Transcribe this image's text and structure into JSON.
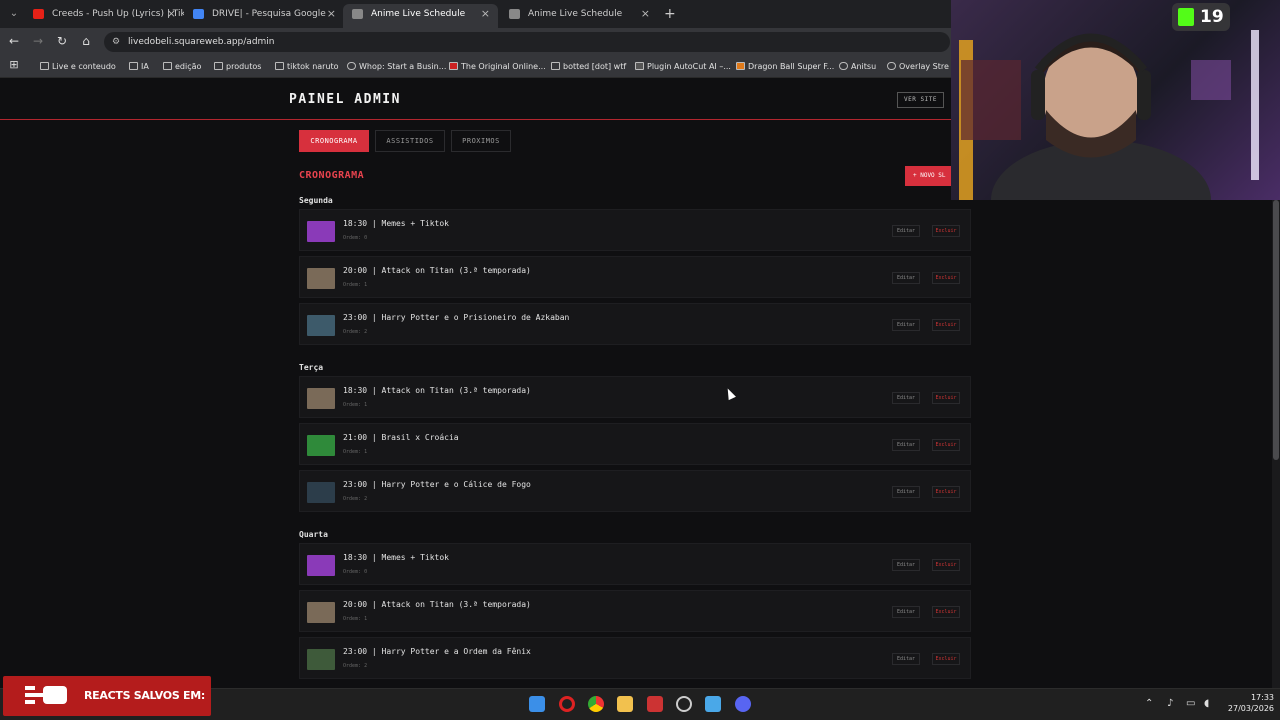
{
  "browser": {
    "tabs": [
      {
        "label": "Creeds - Push Up (Lyrics) | Tiktok",
        "favicon_color": "#e62117"
      },
      {
        "label": "DRIVE| - Pesquisa Google",
        "favicon_color": "#4285f4"
      },
      {
        "label": "Anime Live Schedule",
        "favicon_color": "#888888"
      },
      {
        "label": "Anime Live Schedule",
        "favicon_color": "#888888"
      }
    ],
    "tab_close_glyph": "×",
    "new_tab_glyph": "+",
    "url": "livedobeli.squareweb.app/admin",
    "bookmarks": [
      "Live e conteudo",
      "IA",
      "edição",
      "produtos",
      "tiktok naruto",
      "Whop: Start a Busin...",
      "The Original Online...",
      "botted [dot] wtf",
      "Plugin AutoCut AI –...",
      "Dragon Ball Super F...",
      "Anitsu",
      "Overlay Stre"
    ]
  },
  "admin": {
    "title": "PAINEL ADMIN",
    "ver_site": "VER SITE",
    "nav_tabs": [
      "CRONOGRAMA",
      "ASSISTIDOS",
      "PROXIMOS"
    ],
    "section_title": "CRONOGRAMA",
    "new_button": "+ NOVO SL",
    "edit_label": "Editar",
    "delete_label": "Excluir",
    "days": [
      {
        "name": "Segunda",
        "items": [
          {
            "text": "18:30 | Memes + Tiktok",
            "order": "Ordem: 0",
            "thumb": "#8a3ab8"
          },
          {
            "text": "20:00 | Attack on Titan (3.ª temporada)",
            "order": "Ordem: 1",
            "thumb": "#7a6a58"
          },
          {
            "text": "23:00 | Harry Potter e o Prisioneiro de Azkaban",
            "order": "Ordem: 2",
            "thumb": "#3d5a6a"
          }
        ]
      },
      {
        "name": "Terça",
        "items": [
          {
            "text": "18:30 | Attack on Titan (3.ª temporada)",
            "order": "Ordem: 1",
            "thumb": "#7a6a58"
          },
          {
            "text": "21:00 | Brasil x Croácia",
            "order": "Ordem: 1",
            "thumb": "#2f8a3a"
          },
          {
            "text": "23:00 | Harry Potter e o Cálice de Fogo",
            "order": "Ordem: 2",
            "thumb": "#2c3d4a"
          }
        ]
      },
      {
        "name": "Quarta",
        "items": [
          {
            "text": "18:30 | Memes + Tiktok",
            "order": "Ordem: 0",
            "thumb": "#8a3ab8"
          },
          {
            "text": "20:00 | Attack on Titan (3.ª temporada)",
            "order": "Ordem: 1",
            "thumb": "#7a6a58"
          },
          {
            "text": "23:00 | Harry Potter e a Ordem da Fênix",
            "order": "Ordem: 2",
            "thumb": "#3e5a3a"
          }
        ]
      }
    ]
  },
  "overlay": {
    "kick_count": "19",
    "reacts_banner": "REACTS SALVOS EM:"
  },
  "taskbar": {
    "time": "17:33",
    "date": "27/03/2026",
    "apps": [
      "windows-start",
      "opera",
      "chrome",
      "file-explorer",
      "calendar-app",
      "steam",
      "notepad",
      "discord"
    ]
  },
  "colors": {
    "accent": "#d7303d",
    "background": "#0f0f11",
    "row": "#161618"
  }
}
